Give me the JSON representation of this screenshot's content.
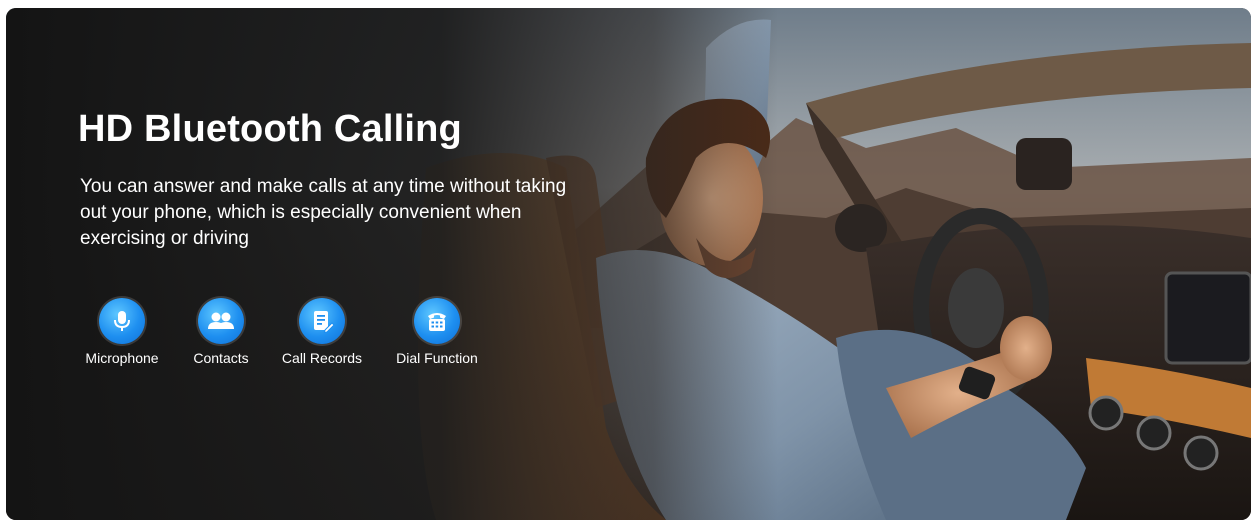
{
  "banner": {
    "title": "HD Bluetooth Calling",
    "description": "You can answer and make calls at any time without taking out your phone, which is especially convenient when exercising or driving"
  },
  "features": [
    {
      "label": "Microphone",
      "icon": "microphone-icon"
    },
    {
      "label": "Contacts",
      "icon": "contacts-icon"
    },
    {
      "label": "Call Records",
      "icon": "call-records-icon"
    },
    {
      "label": "Dial Function",
      "icon": "dial-pad-icon"
    }
  ],
  "colors": {
    "icon_blue": "#1e8ff0",
    "text": "#ffffff",
    "seat_tan": "#b07a45"
  }
}
